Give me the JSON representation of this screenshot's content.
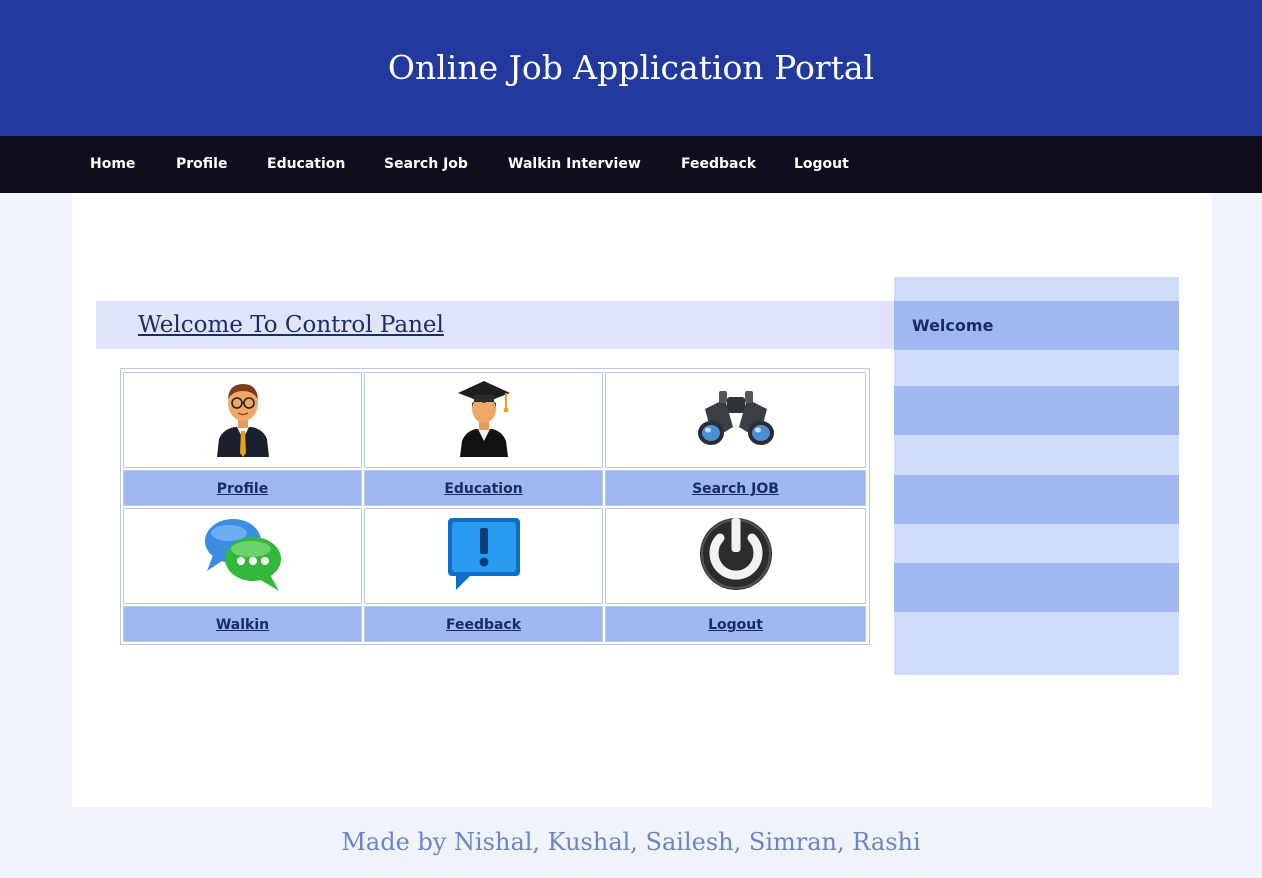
{
  "header": {
    "title": "Online Job Application Portal"
  },
  "nav": {
    "items": [
      {
        "label": "Home"
      },
      {
        "label": "Profile"
      },
      {
        "label": "Education"
      },
      {
        "label": "Search Job"
      },
      {
        "label": "Walkin Interview"
      },
      {
        "label": "Feedback"
      },
      {
        "label": "Logout"
      }
    ]
  },
  "main": {
    "title": "Welcome To Control Panel",
    "tiles": [
      {
        "label": "Profile",
        "icon": "person-icon"
      },
      {
        "label": "Education",
        "icon": "graduate-icon"
      },
      {
        "label": "Search JOB",
        "icon": "binoculars-icon"
      },
      {
        "label": "Walkin",
        "icon": "chat-bubbles-icon"
      },
      {
        "label": "Feedback",
        "icon": "exclamation-bubble-icon"
      },
      {
        "label": "Logout",
        "icon": "power-icon"
      }
    ]
  },
  "sidebar": {
    "heading": "Welcome"
  },
  "footer": {
    "text": "Made by Nishal, Kushal, Sailesh, Simran, Rashi"
  },
  "colors": {
    "header_bg": "#223a9e",
    "nav_bg": "#0e0e1d",
    "label_bg": "#a0b8f2",
    "sidebar_light": "#cfdcf9",
    "welcome_bar": "#e0e5fd",
    "footer_text": "#6b83c8"
  }
}
